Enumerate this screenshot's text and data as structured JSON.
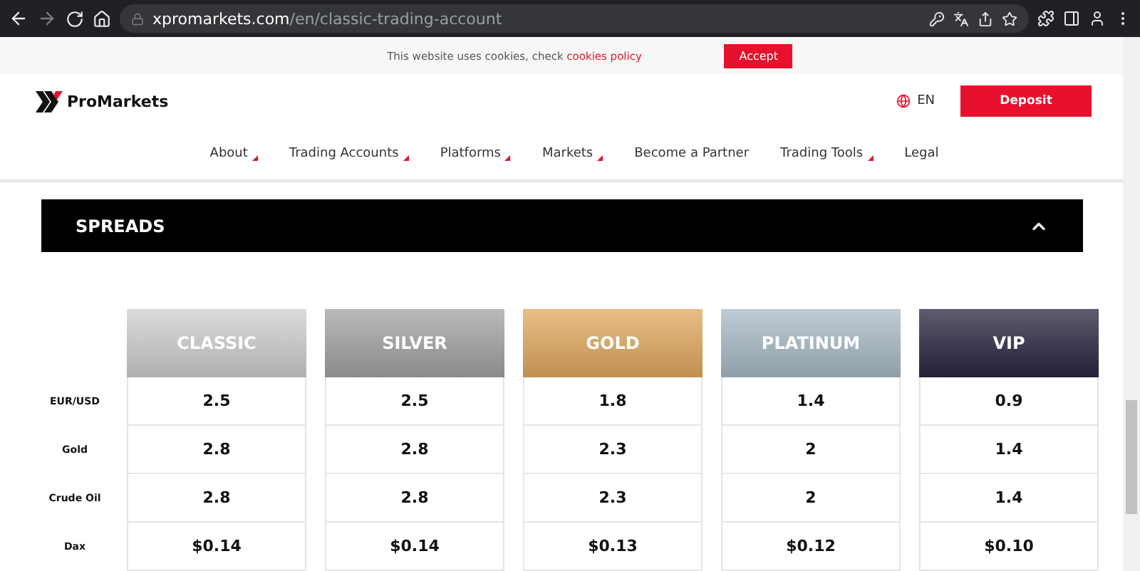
{
  "browser": {
    "url_host": "xpromarkets.com",
    "url_path": "/en/classic-trading-account",
    "forward_disabled": true
  },
  "cookie_bar": {
    "text": "This website uses cookies, check ",
    "link": "cookies policy",
    "button": "Accept"
  },
  "header": {
    "logo": "ProMarkets",
    "language": "EN",
    "deposit": "Deposit"
  },
  "nav": [
    {
      "label": "About",
      "dropdown": true
    },
    {
      "label": "Trading Accounts",
      "dropdown": true
    },
    {
      "label": "Platforms",
      "dropdown": true
    },
    {
      "label": "Markets",
      "dropdown": true
    },
    {
      "label": "Become a Partner",
      "dropdown": false
    },
    {
      "label": "Trading Tools",
      "dropdown": true
    },
    {
      "label": "Legal",
      "dropdown": false
    }
  ],
  "section": {
    "title": "SPREADS",
    "expanded": true
  },
  "table": {
    "columns": [
      {
        "name": "CLASSIC",
        "color": "#cfcfcf"
      },
      {
        "name": "SILVER",
        "color": "#a3a3a3"
      },
      {
        "name": "GOLD",
        "color": "#e2a95e"
      },
      {
        "name": "PLATINUM",
        "color": "#a9bac6"
      },
      {
        "name": "VIP",
        "color": "#2c2541"
      }
    ],
    "rows": [
      {
        "label": "EUR/USD",
        "values": [
          "2.5",
          "2.5",
          "1.8",
          "1.4",
          "0.9"
        ]
      },
      {
        "label": "Gold",
        "values": [
          "2.8",
          "2.8",
          "2.3",
          "2",
          "1.4"
        ]
      },
      {
        "label": "Crude Oil",
        "values": [
          "2.8",
          "2.8",
          "2.3",
          "2",
          "1.4"
        ]
      },
      {
        "label": "Dax",
        "values": [
          "$0.14",
          "$0.14",
          "$0.13",
          "$0.12",
          "$0.10"
        ]
      }
    ]
  }
}
